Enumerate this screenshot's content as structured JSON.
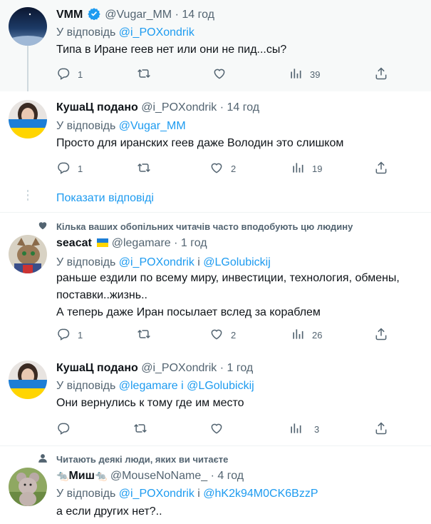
{
  "tweets": [
    {
      "name": "VMM",
      "handle": "@Vugar_MM",
      "time": "14 год",
      "reply_prefix": "У відповідь",
      "reply_to": [
        "@i_POXondrik"
      ],
      "reply_join": "",
      "text": [
        "Типа в Иране геев нет или они не пид...сы?"
      ],
      "replies": "1",
      "retweets": "",
      "likes": "",
      "views": "39"
    },
    {
      "name": "КушаЦ подано",
      "handle": "@i_POXondrik",
      "time": "14 год",
      "reply_prefix": "У відповідь",
      "reply_to": [
        "@Vugar_MM"
      ],
      "reply_join": "",
      "text": [
        "Просто для иранских геев даже Володин это слишком"
      ],
      "replies": "1",
      "retweets": "",
      "likes": "2",
      "views": "19"
    },
    {
      "social_context": "Кілька ваших обопільних читачів часто вподобують цю людину",
      "name": "seacat",
      "handle": "@legamare",
      "time": "1 год",
      "reply_prefix": "У відповідь",
      "reply_to": [
        "@i_POXondrik",
        "@LGolubickij"
      ],
      "reply_join": "і",
      "text": [
        "раньше ездили по всему миру, инвестиции, технология, обмены, поставки..жизнь..",
        "А теперь даже Иран посылает вслед за кораблем"
      ],
      "replies": "1",
      "retweets": "",
      "likes": "2",
      "views": "26"
    },
    {
      "name": "КушаЦ подано",
      "handle": "@i_POXondrik",
      "time": "1 год",
      "reply_prefix": "У відповідь",
      "reply_to": [
        "@legamare",
        "@LGolubickij"
      ],
      "reply_join": "і",
      "text": [
        "Они вернулись к тому где им место"
      ],
      "replies": "",
      "retweets": "",
      "likes": "",
      "views": "3"
    },
    {
      "social_context": "Читають деякі люди, яких ви читаєте",
      "name": "Миш",
      "handle": "@MouseNoName_",
      "time": "4 год",
      "reply_prefix": "У відповідь",
      "reply_to": [
        "@i_POXondrik",
        "@hK2k94M0CK6BzzP"
      ],
      "reply_join": "і",
      "text": [
        "а если других нет?.."
      ]
    }
  ],
  "show_replies": "Показати відповіді",
  "separator": "·",
  "mouse_emoji": "🐀",
  "colors": {
    "link": "#1d9bf0",
    "muted": "#536471",
    "highlight": "#f7f9f9",
    "ukraine_blue": "#1d7ed6",
    "ukraine_yellow": "#ffd500"
  },
  "icons": [
    "reply-icon",
    "retweet-icon",
    "like-icon",
    "views-icon",
    "share-icon",
    "verified-badge-icon",
    "heart-small-icon",
    "person-small-icon"
  ]
}
